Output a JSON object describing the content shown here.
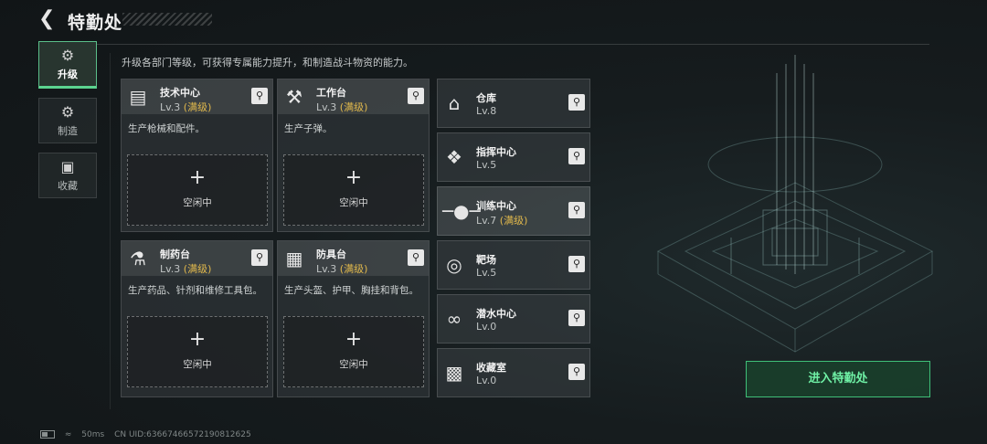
{
  "header": {
    "title": "特勤处"
  },
  "nav": [
    {
      "label": "升级",
      "icon": "upgrade-icon",
      "active": true
    },
    {
      "label": "制造",
      "icon": "gears-icon",
      "active": false
    },
    {
      "label": "收藏",
      "icon": "collection-icon",
      "active": false
    }
  ],
  "description": "升级各部门等级，可获得专属能力提升，和制造战斗物资的能力。",
  "departments": [
    {
      "name": "技术中心",
      "level": "Lv.3",
      "max": "(满级)",
      "text": "生产枪械和配件。",
      "slot": "空闲中",
      "icon": "monitor-icon"
    },
    {
      "name": "工作台",
      "level": "Lv.3",
      "max": "(满级)",
      "text": "生产子弹。",
      "slot": "空闲中",
      "icon": "tools-icon"
    },
    {
      "name": "制药台",
      "level": "Lv.3",
      "max": "(满级)",
      "text": "生产药品、针剂和维修工具包。",
      "slot": "空闲中",
      "icon": "microscope-icon"
    },
    {
      "name": "防具台",
      "level": "Lv.3",
      "max": "(满级)",
      "text": "生产头盔、护甲、胸挂和背包。",
      "slot": "空闲中",
      "icon": "boxes-icon"
    }
  ],
  "facilities": [
    {
      "name": "仓库",
      "level": "Lv.8",
      "max": "",
      "icon": "warehouse-icon"
    },
    {
      "name": "指挥中心",
      "level": "Lv.5",
      "max": "",
      "icon": "chip-icon"
    },
    {
      "name": "训练中心",
      "level": "Lv.7",
      "max": "(满级)",
      "icon": "dumbbell-icon"
    },
    {
      "name": "靶场",
      "level": "Lv.5",
      "max": "",
      "icon": "target-icon"
    },
    {
      "name": "潜水中心",
      "level": "Lv.0",
      "max": "",
      "icon": "goggles-icon"
    },
    {
      "name": "收藏室",
      "level": "Lv.0",
      "max": "",
      "icon": "display-case-icon"
    }
  ],
  "enter_button": "进入特勤处",
  "footer": {
    "ping": "50ms",
    "uid": "CN UID:6366746657219081262​5"
  },
  "colors": {
    "accent": "#5bd38f",
    "max_level": "#e0b84c"
  }
}
